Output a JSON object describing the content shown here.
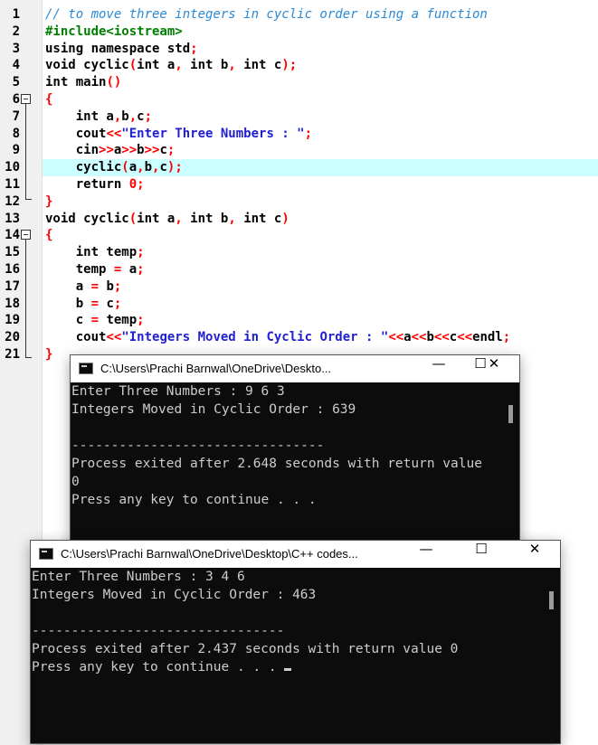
{
  "editor": {
    "lines": [
      {
        "n": "1",
        "html": "<span class=\"cm\">// to move three integers in cyclic order using a function</span>"
      },
      {
        "n": "2",
        "html": "<span class=\"pp\">#include&lt;iostream&gt;</span>"
      },
      {
        "n": "3",
        "html": "using namespace std<span class=\"op\">;</span>"
      },
      {
        "n": "4",
        "html": "void cyclic<span class=\"op\">(</span>int a<span class=\"op\">,</span> int b<span class=\"op\">,</span> int c<span class=\"op\">);</span>"
      },
      {
        "n": "5",
        "html": "int main<span class=\"op\">()</span>"
      },
      {
        "n": "6",
        "html": "<span class=\"op\">{</span>"
      },
      {
        "n": "7",
        "html": "    int a<span class=\"op\">,</span>b<span class=\"op\">,</span>c<span class=\"op\">;</span>"
      },
      {
        "n": "8",
        "html": "    cout<span class=\"op\">&lt;&lt;</span><span class=\"st\">\"Enter Three Numbers : \"</span><span class=\"op\">;</span>"
      },
      {
        "n": "9",
        "html": "    cin<span class=\"op\">&gt;&gt;</span>a<span class=\"op\">&gt;&gt;</span>b<span class=\"op\">&gt;&gt;</span>c<span class=\"op\">;</span>"
      },
      {
        "n": "10",
        "html": "    cyclic<span class=\"op\">(</span>a<span class=\"op\">,</span>b<span class=\"op\">,</span>c<span class=\"op\">);</span>"
      },
      {
        "n": "11",
        "html": "    return <span class=\"num\">0</span><span class=\"op\">;</span>"
      },
      {
        "n": "12",
        "html": "<span class=\"op\">}</span>"
      },
      {
        "n": "13",
        "html": "void cyclic<span class=\"op\">(</span>int a<span class=\"op\">,</span> int b<span class=\"op\">,</span> int c<span class=\"op\">)</span>"
      },
      {
        "n": "14",
        "html": "<span class=\"op\">{</span>"
      },
      {
        "n": "15",
        "html": "    int temp<span class=\"op\">;</span>"
      },
      {
        "n": "16",
        "html": "    temp <span class=\"op\">=</span> a<span class=\"op\">;</span>"
      },
      {
        "n": "17",
        "html": "    a <span class=\"op\">=</span> b<span class=\"op\">;</span>"
      },
      {
        "n": "18",
        "html": "    b <span class=\"op\">=</span> c<span class=\"op\">;</span>"
      },
      {
        "n": "19",
        "html": "    c <span class=\"op\">=</span> temp<span class=\"op\">;</span>"
      },
      {
        "n": "20",
        "html": "    cout<span class=\"op\">&lt;&lt;</span><span class=\"st\">\"Integers Moved in Cyclic Order : \"</span><span class=\"op\">&lt;&lt;</span>a<span class=\"op\">&lt;&lt;</span>b<span class=\"op\">&lt;&lt;</span>c<span class=\"op\">&lt;&lt;</span>endl<span class=\"op\">;</span>"
      },
      {
        "n": "21",
        "html": "<span class=\"op\">}</span>"
      }
    ]
  },
  "console1": {
    "title": "C:\\Users\\Prachi Barnwal\\OneDrive\\Deskto...",
    "lines": [
      "Enter Three Numbers : 9 6 3",
      "Integers Moved in Cyclic Order : 639",
      "",
      "--------------------------------",
      "Process exited after 2.648 seconds with return value",
      "0",
      "Press any key to continue . . ."
    ]
  },
  "console2": {
    "title": "C:\\Users\\Prachi Barnwal\\OneDrive\\Desktop\\C++ codes...",
    "lines": [
      "Enter Three Numbers : 3 4 6",
      "Integers Moved in Cyclic Order : 463",
      "",
      "--------------------------------",
      "Process exited after 2.437 seconds with return value 0",
      "Press any key to continue . . . "
    ]
  },
  "controls": {
    "minimize": "—",
    "maximize": "☐",
    "close": "✕"
  },
  "colors": {
    "comment": "#2a8ad6",
    "preprocessor": "#008000",
    "string": "#1f1fd0",
    "operator": "#ff0000",
    "highlight": "#ccffff",
    "console_bg": "#0c0c0c",
    "console_text": "#cccccc"
  }
}
